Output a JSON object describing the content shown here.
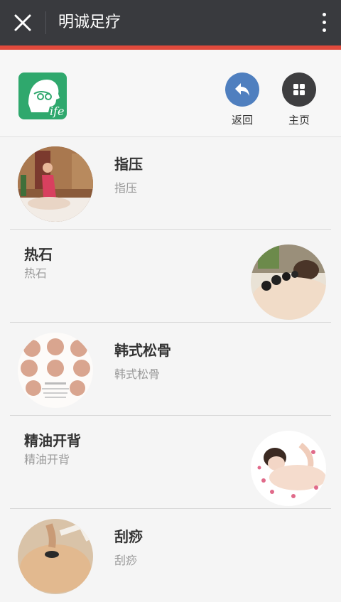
{
  "titlebar": {
    "title": "明诚足疗"
  },
  "header": {
    "logo_text": "ife",
    "back_label": "返回",
    "home_label": "主页",
    "colors": {
      "back": "#4f7fbf",
      "home": "#3e3e40",
      "logo": "#2fa86d",
      "accent_line": "#e14a3c"
    }
  },
  "items": [
    {
      "title": "指压",
      "subtitle": "指压"
    },
    {
      "title": "热石",
      "subtitle": "热石"
    },
    {
      "title": "韩式松骨",
      "subtitle": "韩式松骨"
    },
    {
      "title": "精油开背",
      "subtitle": "精油开背"
    },
    {
      "title": "刮痧",
      "subtitle": "刮痧"
    }
  ]
}
